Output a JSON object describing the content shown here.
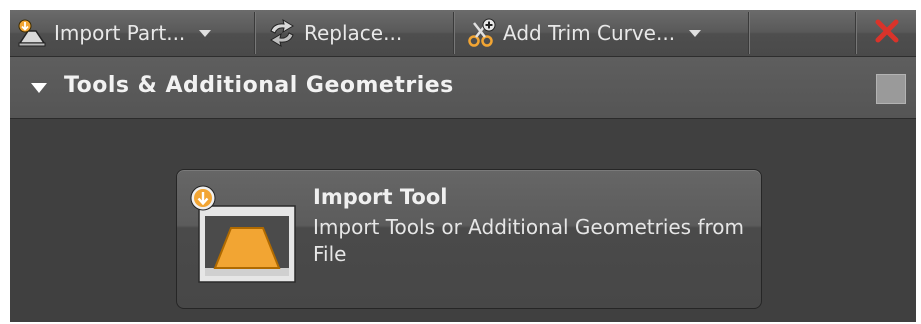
{
  "toolbar": {
    "import_part": {
      "label": "Import Part...",
      "icon": "import-part-icon"
    },
    "replace": {
      "label": "Replace...",
      "icon": "replace-icon"
    },
    "add_trim_curve": {
      "label": "Add Trim Curve...",
      "icon": "scissors-icon"
    },
    "close": {
      "icon": "close-icon",
      "color": "#d9332a"
    }
  },
  "panel": {
    "title": "Tools & Additional Geometries",
    "card": {
      "title": "Import Tool",
      "description": "Import Tools or Additional Geometries from File",
      "icon": "import-tool-icon",
      "accent": "#f2a533"
    }
  }
}
